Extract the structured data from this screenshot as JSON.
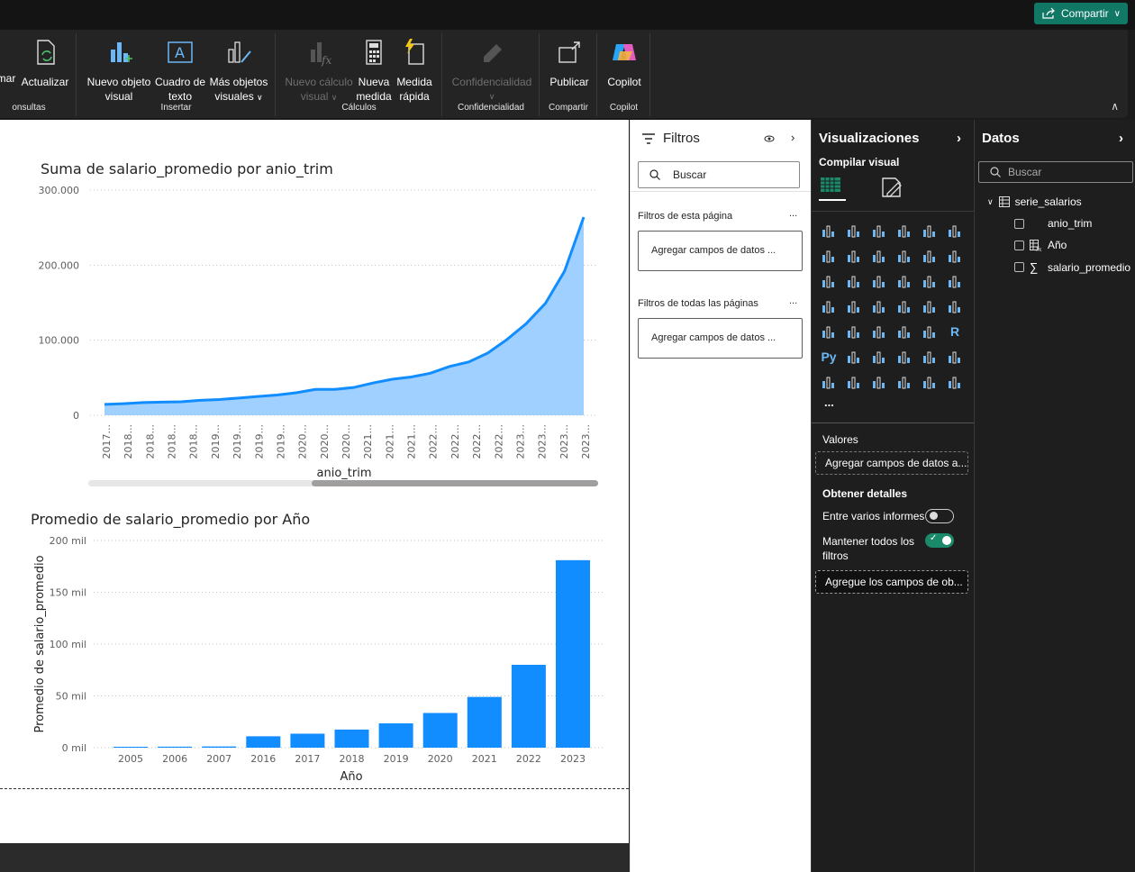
{
  "topbar": {
    "share_label": "Compartir"
  },
  "ribbon": {
    "groups": {
      "consultas": "onsultas",
      "insertar": "Insertar",
      "calculos": "Cálculos",
      "confidencialidad": "Confidencialidad",
      "compartir": "Compartir",
      "copilot": "Copilot"
    },
    "buttons": {
      "transformar": "mar",
      "actualizar": "Actualizar",
      "nuevo_visual_1": "Nuevo objeto",
      "nuevo_visual_2": "visual",
      "cuadro_texto_1": "Cuadro de",
      "cuadro_texto_2": "texto",
      "mas_objetos_1": "Más objetos",
      "mas_objetos_2": "visuales",
      "nuevo_calculo_1": "Nuevo cálculo",
      "nuevo_calculo_2": "visual",
      "nueva_medida_1": "Nueva",
      "nueva_medida_2": "medida",
      "medida_rapida_1": "Medida",
      "medida_rapida_2": "rápida",
      "confidencialidad": "Confidencialidad",
      "publicar": "Publicar",
      "copilot": "Copilot"
    }
  },
  "canvas": {
    "chart1_title": "Suma de salario_promedio por anio_trim",
    "chart2_title": "Promedio de salario_promedio por Año"
  },
  "chart_data": [
    {
      "type": "area",
      "title": "Suma de salario_promedio por anio_trim",
      "xlabel": "anio_trim",
      "ylabel": "",
      "x_tick_labels": [
        "2017...",
        "2018...",
        "2018...",
        "2018...",
        "2018...",
        "2019...",
        "2019...",
        "2019...",
        "2019...",
        "2020...",
        "2020...",
        "2020...",
        "2021...",
        "2021...",
        "2021...",
        "2022...",
        "2022...",
        "2022...",
        "2022...",
        "2023...",
        "2023...",
        "2023...",
        "2023..."
      ],
      "y_ticks": [
        "300.000",
        "200.000",
        "100.000",
        "0"
      ],
      "ylim": [
        0,
        300000
      ],
      "values": [
        14500,
        15500,
        17000,
        17500,
        18000,
        20000,
        21000,
        23000,
        25000,
        27000,
        30000,
        34500,
        34500,
        37000,
        43000,
        48000,
        51000,
        56000,
        65000,
        71000,
        83000,
        101000,
        122000,
        149000,
        192000,
        264000
      ],
      "grid": true
    },
    {
      "type": "bar",
      "title": "Promedio de salario_promedio por Año",
      "xlabel": "Año",
      "ylabel": "Promedio de salario_promedio",
      "categories": [
        "2005",
        "2006",
        "2007",
        "2016",
        "2017",
        "2018",
        "2019",
        "2020",
        "2021",
        "2022",
        "2023"
      ],
      "values": [
        900,
        1000,
        1200,
        11000,
        13500,
        17500,
        23500,
        33500,
        49000,
        80000,
        181000
      ],
      "y_ticks": [
        "200 mil",
        "150 mil",
        "100 mil",
        "50 mil",
        "0 mil"
      ],
      "ylim": [
        0,
        200000
      ],
      "grid": true
    }
  ],
  "filters": {
    "title": "Filtros",
    "search_placeholder": "Buscar",
    "page_section": "Filtros de esta página",
    "all_section": "Filtros de todas las páginas",
    "add_fields_1": "Agregar campos de datos ...",
    "add_fields_2": "Agregar campos de datos ...",
    "more": "...",
    "more2": "..."
  },
  "viz": {
    "title": "Visualizaciones",
    "build_label": "Compilar visual",
    "more_label": "...",
    "valores_label": "Valores",
    "valores_well": "Agregar campos de datos a...",
    "detalles_label": "Obtener detalles",
    "cross_report": "Entre varios informes",
    "keep_filters_1": "Mantener todos los",
    "keep_filters_2": "filtros",
    "detalles_well": "Agregue los campos de ob...",
    "icons": [
      "stacked-bar",
      "stacked-column",
      "clustered-bar",
      "clustered-column",
      "100-bar",
      "100-column",
      "line",
      "area",
      "stacked-area",
      "ribbon",
      "waterfall",
      "line-column",
      "line-clustered",
      "ribbon-chart",
      "funnel",
      "scatter",
      "pie",
      "donut",
      "treemap",
      "map",
      "filled-map",
      "azure-map",
      "gauge",
      "card",
      "multirow-card",
      "kpi",
      "slicer",
      "table",
      "matrix",
      "r-visual",
      "python-visual",
      "key-influencers",
      "decomposition",
      "qa",
      "narrative",
      "goals",
      "paginated",
      "metrics",
      "power-apps",
      "power-automate",
      "diamond",
      "chevron"
    ],
    "r_label": "R",
    "py_label": "Py"
  },
  "data": {
    "title": "Datos",
    "search_placeholder": "Buscar",
    "table": "serie_salarios",
    "fields": [
      "anio_trim",
      "Año",
      "salario_promedio"
    ]
  },
  "colors": {
    "accent": "#118dff",
    "area_fill": "#9fd0ff",
    "share": "#117865"
  }
}
